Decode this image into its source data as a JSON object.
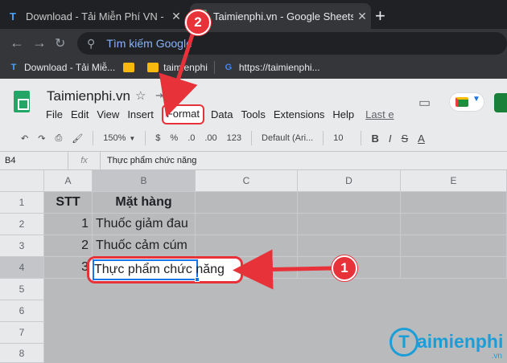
{
  "browser": {
    "tabs": [
      {
        "title": "Download - Tải Miễn Phí VN - Ph",
        "favicon": "T",
        "active": false
      },
      {
        "title": "Taimienphi.vn - Google Sheets",
        "favicon": "sheets-icon",
        "active": true
      }
    ],
    "omnibox_placeholder": "Tìm kiếm Google",
    "bookmarks": [
      {
        "label": "Download - Tải Miễ...",
        "icon": "T"
      },
      {
        "label": "",
        "icon": "folder-icon"
      },
      {
        "label": "taimienphi",
        "icon": "folder-icon"
      },
      {
        "label": "https://taimienphi...",
        "icon": "google-icon"
      }
    ]
  },
  "sheet": {
    "title": "Taimienphi.vn",
    "menus": [
      "File",
      "Edit",
      "View",
      "Insert",
      "Format",
      "Data",
      "Tools",
      "Extensions",
      "Help"
    ],
    "last_edit": "Last e",
    "toolbar": {
      "zoom": "150%",
      "currency": "$",
      "percent": "%",
      "decimal_less": ".0",
      "decimal_more": ".00",
      "more_formats": "123",
      "font": "Default (Ari...",
      "font_size": "10",
      "bold": "B",
      "italic": "I",
      "strike": "S",
      "text_color": "A"
    },
    "name_box": "B4",
    "formula": "Thực phẩm chức năng",
    "columns": [
      "A",
      "B",
      "C",
      "D",
      "E"
    ],
    "rows": [
      "1",
      "2",
      "3",
      "4",
      "5",
      "6",
      "7",
      "8"
    ],
    "cells": {
      "A1": "STT",
      "B1": "Mặt hàng",
      "A2": "1",
      "B2": "Thuốc giảm đau",
      "A3": "2",
      "B3": "Thuốc cảm cúm",
      "A4": "3",
      "B4": "Thực phẩm chức năng"
    }
  },
  "callouts": {
    "one": "1",
    "two": "2"
  },
  "watermark": {
    "brand": "aimienphi",
    "initial": "T",
    "tld": ".vn"
  },
  "colors": {
    "callout": "#e8323a",
    "sheets_green": "#23a566",
    "selection": "#1a73e8"
  }
}
